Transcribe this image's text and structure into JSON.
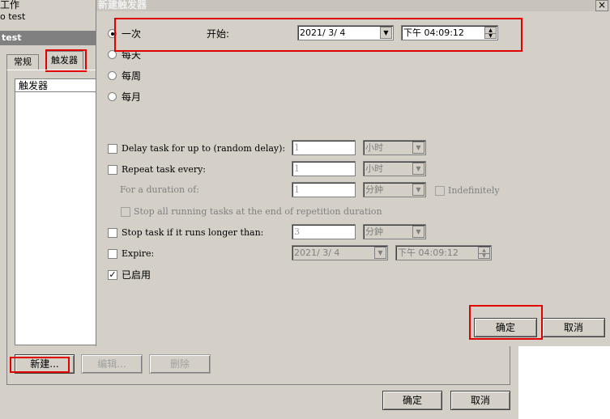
{
  "background_window": {
    "title_line1": "工作",
    "title_line2": "o test",
    "task_bar": "test",
    "tabs": [
      {
        "label": "常规"
      },
      {
        "label": "触发器"
      }
    ],
    "list_header": "触发器",
    "buttons": {
      "new": "新建...",
      "edit": "编辑...",
      "delete": "删除",
      "ok": "确定",
      "cancel": "取消"
    }
  },
  "dialog": {
    "title": "新建触发器",
    "close_glyph": "×",
    "schedule": {
      "options": [
        {
          "label": "一次",
          "selected": true
        },
        {
          "label": "每天",
          "selected": false
        },
        {
          "label": "每周",
          "selected": false
        },
        {
          "label": "每月",
          "selected": false
        }
      ],
      "start_label": "开始:",
      "start_date": "2021/ 3/ 4",
      "start_time": "下午 04:09:12"
    },
    "advanced": {
      "delay": {
        "label": "Delay task for up to (random delay):",
        "value": "1",
        "unit": "小时",
        "checked": false
      },
      "repeat": {
        "label": "Repeat task every:",
        "value": "1",
        "unit": "小时",
        "checked": false
      },
      "duration": {
        "label": "For a duration of:",
        "value": "1",
        "unit": "分鈡",
        "indefinitely_label": "Indefinitely",
        "indefinitely_checked": false
      },
      "stop_all": {
        "label": "Stop all running tasks at the end of repetition duration",
        "checked": false
      },
      "stop_if_longer": {
        "label": "Stop task if it runs longer than:",
        "value": "3",
        "unit": "分鈡",
        "checked": false
      },
      "expire": {
        "label": "Expire:",
        "date": "2021/ 3/ 4",
        "time": "下午 04:09:12",
        "checked": false
      },
      "enabled": {
        "label": "已启用",
        "checked": true,
        "check_glyph": "✓"
      }
    },
    "buttons": {
      "ok": "确定",
      "cancel": "取消"
    },
    "dropdown_glyph": "▼",
    "spin_up_glyph": "▲",
    "spin_down_glyph": "▼"
  },
  "colors": {
    "highlight_box": "#e00000",
    "window_face": "#d4d0c8"
  }
}
